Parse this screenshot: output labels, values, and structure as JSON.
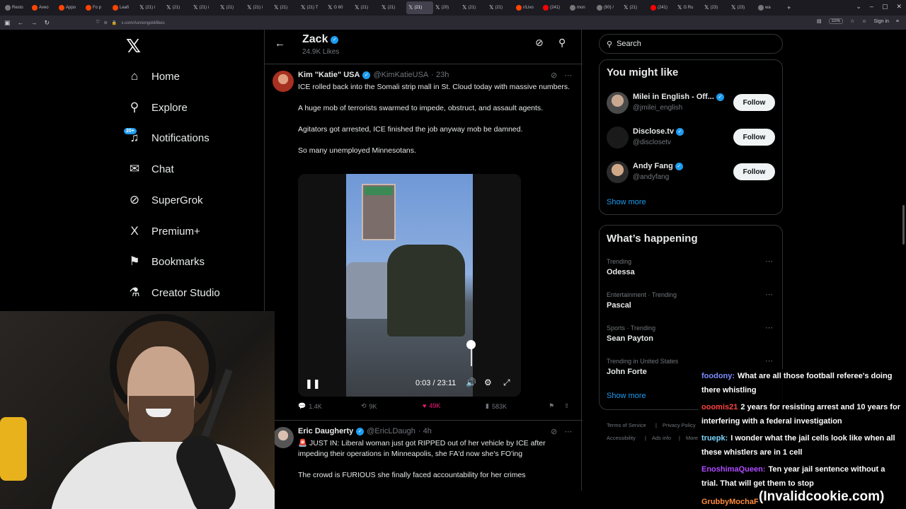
{
  "browser": {
    "tabs": [
      {
        "label": "Resto",
        "icon": "globe"
      },
      {
        "label": "Aveo",
        "icon": "reddit"
      },
      {
        "label": "Appo",
        "icon": "reddit"
      },
      {
        "label": "Fo p",
        "icon": "reddit"
      },
      {
        "label": "Leafi",
        "icon": "reddit"
      },
      {
        "label": "(21) i",
        "icon": "x"
      },
      {
        "label": "(21) ",
        "icon": "x"
      },
      {
        "label": "(21) i",
        "icon": "x"
      },
      {
        "label": "(21) ",
        "icon": "x"
      },
      {
        "label": "(21) i",
        "icon": "x"
      },
      {
        "label": "(21) ",
        "icon": "x"
      },
      {
        "label": "(21) T",
        "icon": "x"
      },
      {
        "label": "G 60",
        "icon": "x"
      },
      {
        "label": "(21) ",
        "icon": "x"
      },
      {
        "label": "(21) ",
        "icon": "x"
      },
      {
        "label": "(21) ",
        "icon": "x",
        "active": true
      },
      {
        "label": "(20) ",
        "icon": "x"
      },
      {
        "label": "(21) ",
        "icon": "x"
      },
      {
        "label": "(21) ",
        "icon": "x"
      },
      {
        "label": "r/Livo",
        "icon": "reddit"
      },
      {
        "label": "(241)",
        "icon": "youtube"
      },
      {
        "label": "mon",
        "icon": "globe"
      },
      {
        "label": "(90) /",
        "icon": "globe"
      },
      {
        "label": "(21) ",
        "icon": "x"
      },
      {
        "label": "(241)",
        "icon": "youtube"
      },
      {
        "label": "G Ru",
        "icon": "x"
      },
      {
        "label": "(23) ",
        "icon": "x"
      },
      {
        "label": "(23) ",
        "icon": "x"
      },
      {
        "label": "wa",
        "icon": "globe"
      }
    ],
    "url": "x.com/Asmongold/likes",
    "zoom": "110%",
    "signin": "Sign in"
  },
  "nav": {
    "items": [
      {
        "label": "Home",
        "icon": "⌂"
      },
      {
        "label": "Explore",
        "icon": "⚲"
      },
      {
        "label": "Notifications",
        "icon": "♫"
      },
      {
        "label": "Chat",
        "icon": "✉"
      },
      {
        "label": "SuperGrok",
        "icon": "⊘"
      },
      {
        "label": "Premium+",
        "icon": "X"
      },
      {
        "label": "Bookmarks",
        "icon": "⚑"
      },
      {
        "label": "Creator Studio",
        "icon": "⚗"
      }
    ],
    "notif_badge": "20+"
  },
  "profile_header": {
    "name": "Zack",
    "likes": "24.9K Likes"
  },
  "tweet1": {
    "name": "Kim \"Katie\" USA",
    "handle": "@KimKatieUSA",
    "time": "· 23h",
    "paragraphs": [
      "ICE rolled back into the Somali strip mall in St. Cloud today with massive numbers.",
      "A huge mob of terrorists swarmed to impede, obstruct, and assault agents.",
      "Agitators got arrested, ICE finished the job anyway mob be damned.",
      "So many unemployed Minnesotans."
    ],
    "video_time": "0:03 / 23:11",
    "video_progress": 0.002,
    "metrics": {
      "replies": "1.4K",
      "reposts": "9K",
      "likes": "49K",
      "views": "583K"
    }
  },
  "tweet2": {
    "name": "Eric Daugherty",
    "handle": "@EricLDaugh",
    "time": "· 4h",
    "paragraphs": [
      "🚨 JUST IN: Liberal woman just got RIPPED out of her vehicle by ICE after impeding their operations in Minneapolis, she FA'd now she's FO'ing",
      "The crowd is FURIOUS she finally faced accountability for her crimes"
    ]
  },
  "right": {
    "search_placeholder": "Search",
    "suggestions_title": "You might like",
    "suggestions": [
      {
        "name": "Milei in English - Off...",
        "handle": "@jmilei_english",
        "follow": "Follow"
      },
      {
        "name": "Disclose.tv",
        "handle": "@disclosetv",
        "follow": "Follow"
      },
      {
        "name": "Andy Fang",
        "handle": "@andyfang",
        "follow": "Follow"
      }
    ],
    "show_more": "Show more",
    "happening_title": "What’s happening",
    "trends": [
      {
        "context": "Trending",
        "name": "Odessa"
      },
      {
        "context": "Entertainment · Trending",
        "name": "Pascal"
      },
      {
        "context": "Sports · Trending",
        "name": "Sean Payton"
      },
      {
        "context": "Trending in United States",
        "name": "John Forte"
      }
    ],
    "footer": [
      "Terms of Service",
      "Privacy Policy",
      "Accessibility",
      "Ads info",
      "More"
    ]
  },
  "chat": {
    "messages": [
      {
        "user": "foodony:",
        "text": "What are all those football referee's doing there whistling",
        "color": "#7b8cff"
      },
      {
        "user": "ooomis21",
        "text": "2 years for resisting arrest and 10 years for interfering with a federal investigation",
        "color": "#ff4040"
      },
      {
        "user": "truepk:",
        "text": "I wonder what the jail cells look like when all these whistlers are in 1 cell",
        "color": "#7bd6ff"
      },
      {
        "user": "EnoshimaQueen:",
        "text": "Ten year jail sentence without a trial. That will get them to stop",
        "color": "#b04cff"
      },
      {
        "user": "GrubbyMochaF",
        "text": "",
        "color": "#ff8a3c"
      }
    ]
  },
  "watermark": "(Invalidcookie.com)"
}
